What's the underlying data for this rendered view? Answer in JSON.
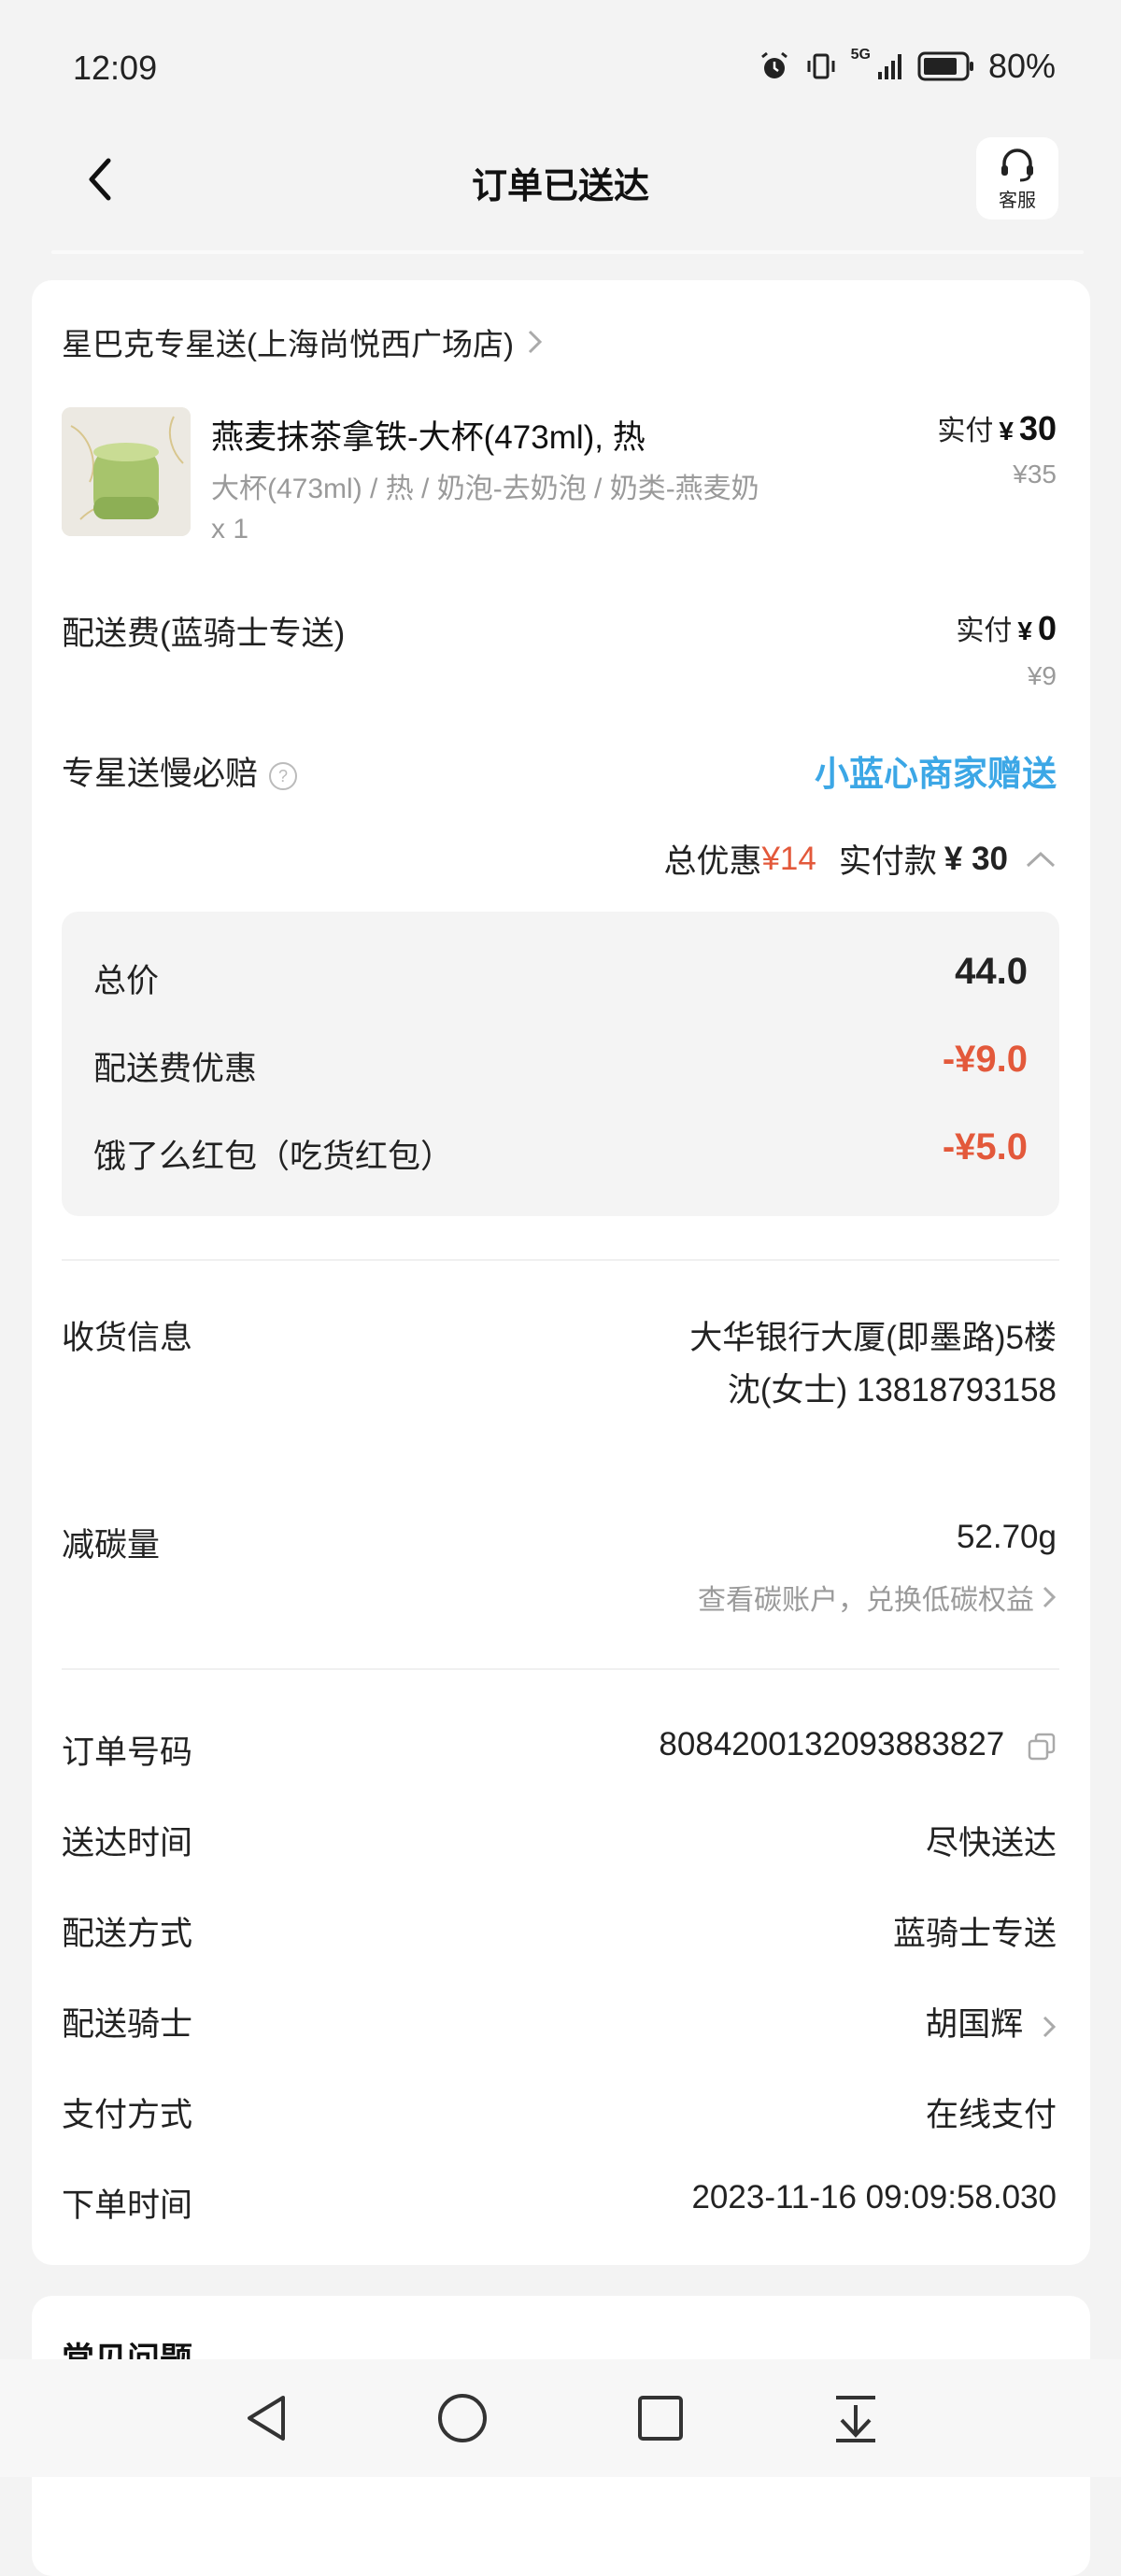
{
  "status_bar": {
    "time": "12:09",
    "network": "5G",
    "battery": "80%"
  },
  "header": {
    "title": "订单已送达",
    "service_label": "客服"
  },
  "store": {
    "name": "星巴克专星送(上海尚悦西广场店)"
  },
  "product": {
    "name": "燕麦抹茶拿铁-大杯(473ml), 热",
    "spec": "大杯(473ml) / 热 / 奶泡-去奶泡 / 奶类-燕麦奶",
    "qty": "x 1",
    "paid_label": "实付",
    "paid_yen": "¥",
    "paid_value": "30",
    "original_price": "¥35"
  },
  "delivery_fee": {
    "label": "配送费(蓝骑士专送)",
    "paid_label": "实付",
    "paid_yen": "¥",
    "paid_value": "0",
    "original_price": "¥9"
  },
  "guarantee": {
    "label": "专星送慢必赔",
    "help_icon": "?",
    "link": "小蓝心商家赠送"
  },
  "summary": {
    "discount_label": "总优惠",
    "discount_value": "¥14",
    "paid_label": "实付款",
    "paid_value": "¥ 30"
  },
  "breakdown": [
    {
      "label": "总价",
      "value": "44.0"
    },
    {
      "label": "配送费优惠",
      "value": "-¥9.0"
    },
    {
      "label": "饿了么红包（吃货红包）",
      "value": "-¥5.0"
    }
  ],
  "receiver": {
    "label": "收货信息",
    "address": "大华银行大厦(即墨路)5楼",
    "contact": "沈(女士) 13818793158"
  },
  "carbon": {
    "label": "减碳量",
    "value": "52.70g",
    "link": "查看碳账户，兑换低碳权益"
  },
  "order_info": [
    {
      "label": "订单号码",
      "value": "8084200132093883827"
    },
    {
      "label": "送达时间",
      "value": "尽快送达"
    },
    {
      "label": "配送方式",
      "value": "蓝骑士专送"
    },
    {
      "label": "配送骑士",
      "value": "胡国辉"
    },
    {
      "label": "支付方式",
      "value": "在线支付"
    },
    {
      "label": "下单时间",
      "value": "2023-11-16 09:09:58.030"
    }
  ],
  "next_section": {
    "title": "常见问题"
  },
  "colors": {
    "accent_blue": "#3ca7e6",
    "discount_red": "#e3593b"
  }
}
